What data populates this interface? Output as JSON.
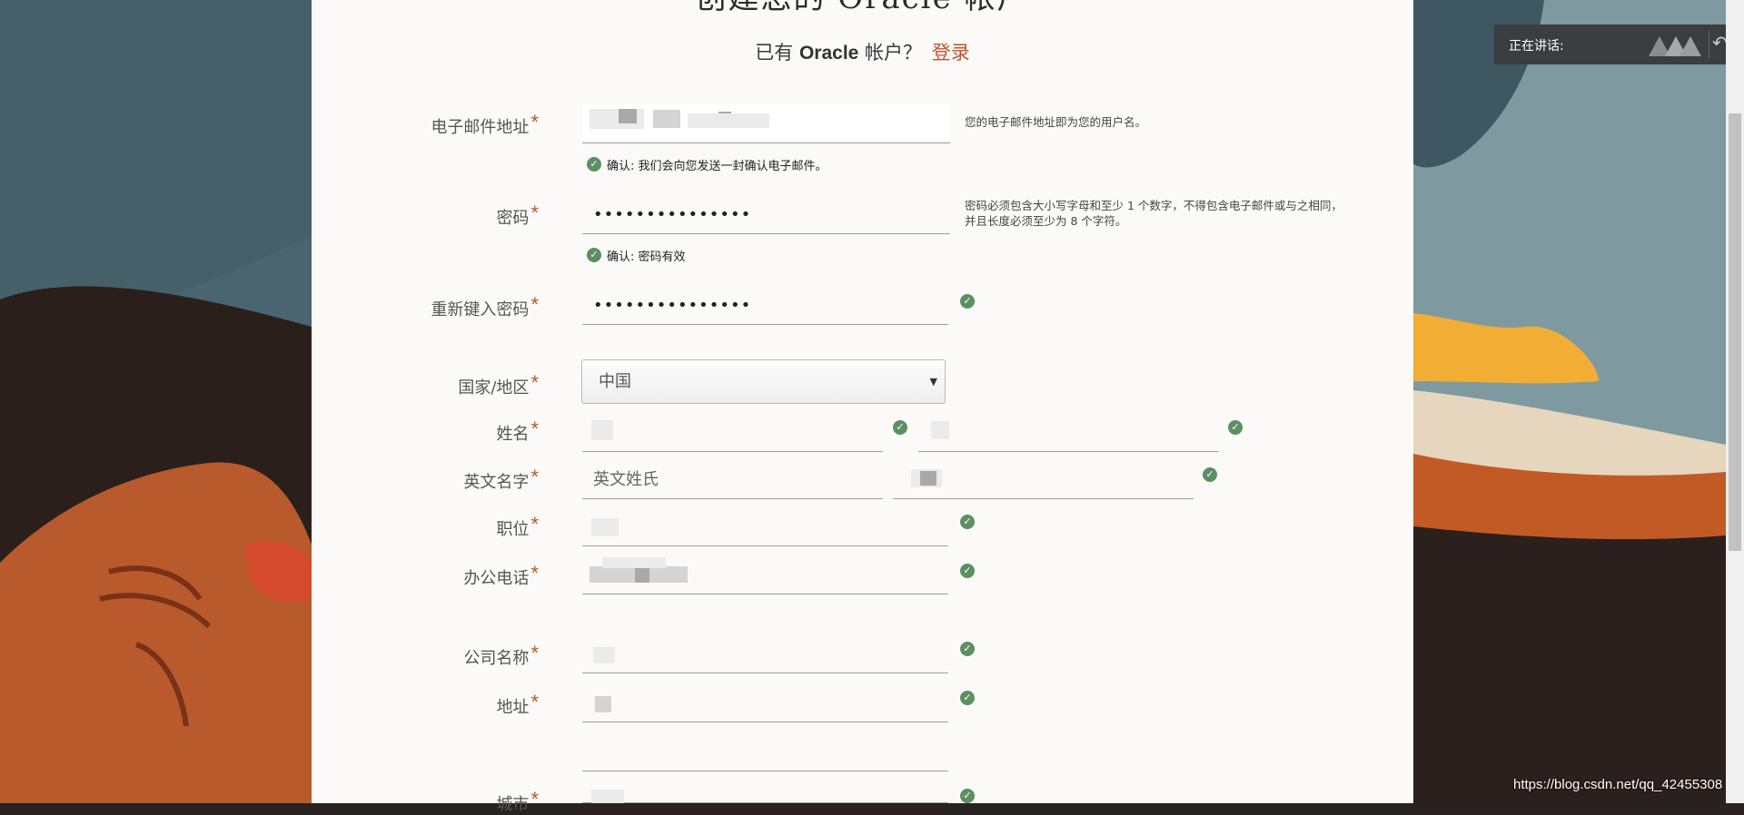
{
  "page": {
    "heading_partial": "创建您的 Oracle 帐户",
    "have_account_prefix": "已有",
    "have_account_brand": "Oracle",
    "have_account_suffix": "帐户？",
    "login_link": "登录"
  },
  "form": {
    "email": {
      "label": "电子邮件地址",
      "hint": "您的电子邮件地址即为您的用户名。",
      "confirm": "确认: 我们会向您发送一封确认电子邮件。"
    },
    "password": {
      "label": "密码",
      "value": "•••••••••••••••",
      "hint": "密码必须包含大小写字母和至少 1 个数字，不得包含电子邮件或与之相同，并且长度必须至少为 8 个字符。",
      "confirm": "确认: 密码有效"
    },
    "password_repeat": {
      "label": "重新键入密码",
      "value": "•••••••••••••••"
    },
    "country": {
      "label": "国家/地区",
      "value": "中国"
    },
    "name": {
      "label": "姓名"
    },
    "english_name": {
      "label": "英文名字",
      "placeholder": "英文姓氏"
    },
    "job_title": {
      "label": "职位"
    },
    "office_phone": {
      "label": "办公电话"
    },
    "company": {
      "label": "公司名称"
    },
    "address": {
      "label": "地址"
    },
    "city": {
      "label": "城市"
    },
    "required_mark": "*"
  },
  "overlay": {
    "speaking_label": "正在讲话:",
    "reply_icon": "reply-arrow-icon"
  },
  "watermark": "https://blog.csdn.net/qq_42455308",
  "colors": {
    "accent": "#c2542a",
    "check": "#5c8f62",
    "panel": "#fbfaf9"
  }
}
